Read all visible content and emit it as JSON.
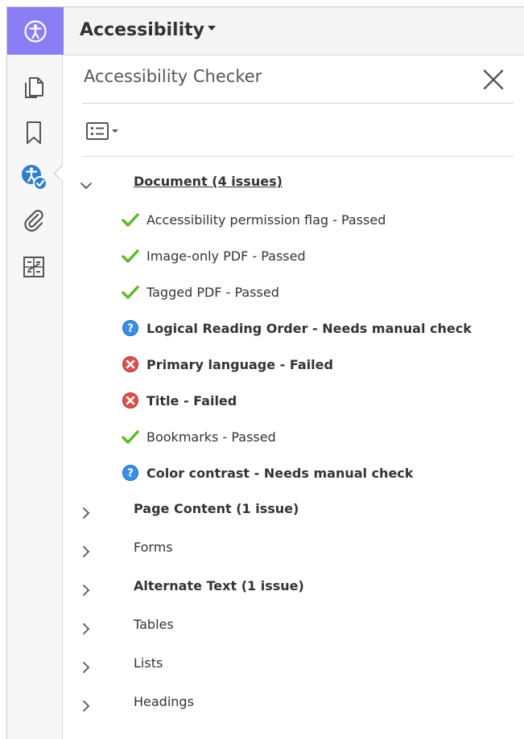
{
  "header": {
    "title": "Accessibility"
  },
  "rail": {
    "icons": [
      "accessibility-tool-icon",
      "pages-icon",
      "bookmark-icon",
      "accessibility-check-icon",
      "attachment-icon",
      "content-order-icon"
    ]
  },
  "checker": {
    "title": "Accessibility Checker",
    "document_group": {
      "label": "Document (4 issues)",
      "expanded": true,
      "items": [
        {
          "label": "Accessibility permission flag - Passed",
          "status": "passed"
        },
        {
          "label": "Image-only PDF - Passed",
          "status": "passed"
        },
        {
          "label": "Tagged PDF - Passed",
          "status": "passed"
        },
        {
          "label": "Logical Reading Order - Needs manual check",
          "status": "manual"
        },
        {
          "label": "Primary language - Failed",
          "status": "failed"
        },
        {
          "label": "Title - Failed",
          "status": "failed"
        },
        {
          "label": "Bookmarks - Passed",
          "status": "passed"
        },
        {
          "label": "Color contrast - Needs manual check",
          "status": "manual"
        }
      ]
    },
    "groups": [
      {
        "label": "Page Content (1 issue)",
        "bold": true
      },
      {
        "label": "Forms",
        "bold": false
      },
      {
        "label": "Alternate Text (1 issue)",
        "bold": true
      },
      {
        "label": "Tables",
        "bold": false
      },
      {
        "label": "Lists",
        "bold": false
      },
      {
        "label": "Headings",
        "bold": false
      }
    ]
  },
  "colors": {
    "accent_purple": "#8a7ef4",
    "passed_green": "#5cb82a",
    "failed_red": "#d9534f",
    "manual_blue": "#3a8ee6"
  }
}
